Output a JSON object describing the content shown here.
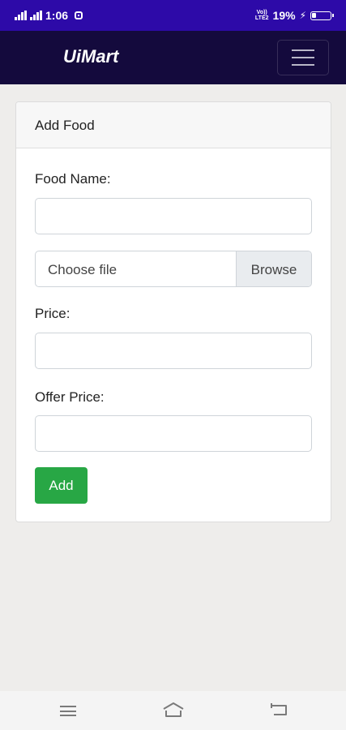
{
  "status_bar": {
    "network_left": "4G",
    "time": "1:06",
    "volte_label_top": "Vo))",
    "volte_label_bottom": "LTE2",
    "battery_percent": "19%",
    "bolt": "⚡",
    "notification_icon": "square-notification-icon"
  },
  "navbar": {
    "brand": "UiMart",
    "toggler_icon": "hamburger-icon"
  },
  "card": {
    "header_title": "Add Food",
    "food_name_label": "Food Name:",
    "food_name_value": "",
    "file_label": "Choose file",
    "file_browse": "Browse",
    "price_label": "Price:",
    "price_value": "",
    "offer_price_label": "Offer Price:",
    "offer_price_value": "",
    "add_button": "Add"
  },
  "bottom_nav": {
    "menu_icon": "menu-icon",
    "home_icon": "home-icon",
    "back_icon": "back-icon"
  },
  "colors": {
    "status_bar": "#2d0aa8",
    "navbar": "#140a3d",
    "page_background": "#eeedeb",
    "add_button": "#28a745"
  }
}
